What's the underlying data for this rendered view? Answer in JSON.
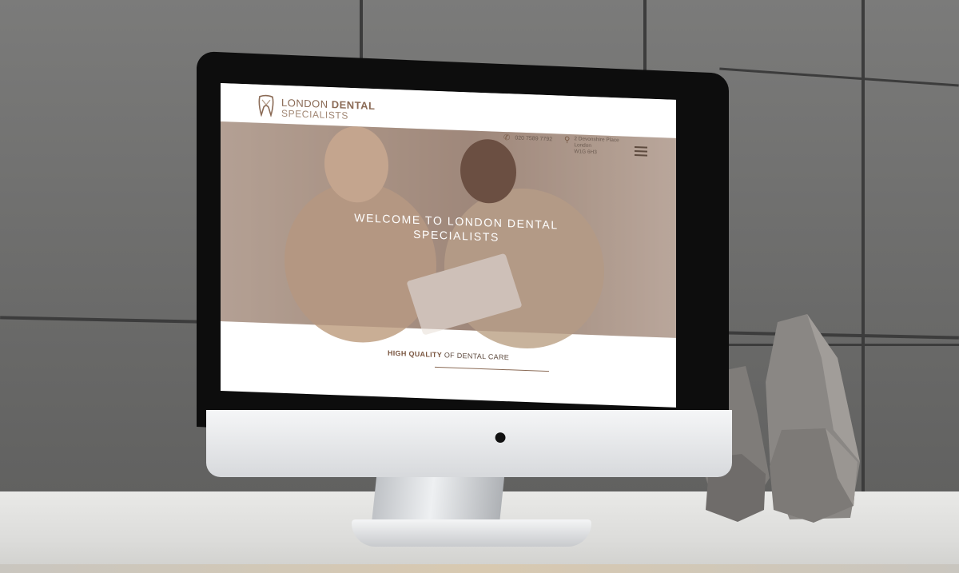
{
  "site": {
    "logo_line1_light": "LONDON ",
    "logo_line1_bold": "DENTAL",
    "logo_line2": "SPECIALISTS",
    "phone": "020 7589 7792",
    "address_line1": "2 Devonshire Place",
    "address_line2": "London",
    "address_line3": "W1G 6H3",
    "hero_title": "WELCOME TO LONDON DENTAL SPECIALISTS",
    "tagline_bold": "HIGH QUALITY",
    "tagline_rest": " OF DENTAL CARE"
  },
  "icons": {
    "phone": "phone-icon",
    "location": "location-pin-icon",
    "menu": "hamburger-menu-icon",
    "apple": "apple-logo-icon"
  },
  "colors": {
    "brand_brown": "#8a6a55",
    "accent_text": "#7a5640"
  }
}
